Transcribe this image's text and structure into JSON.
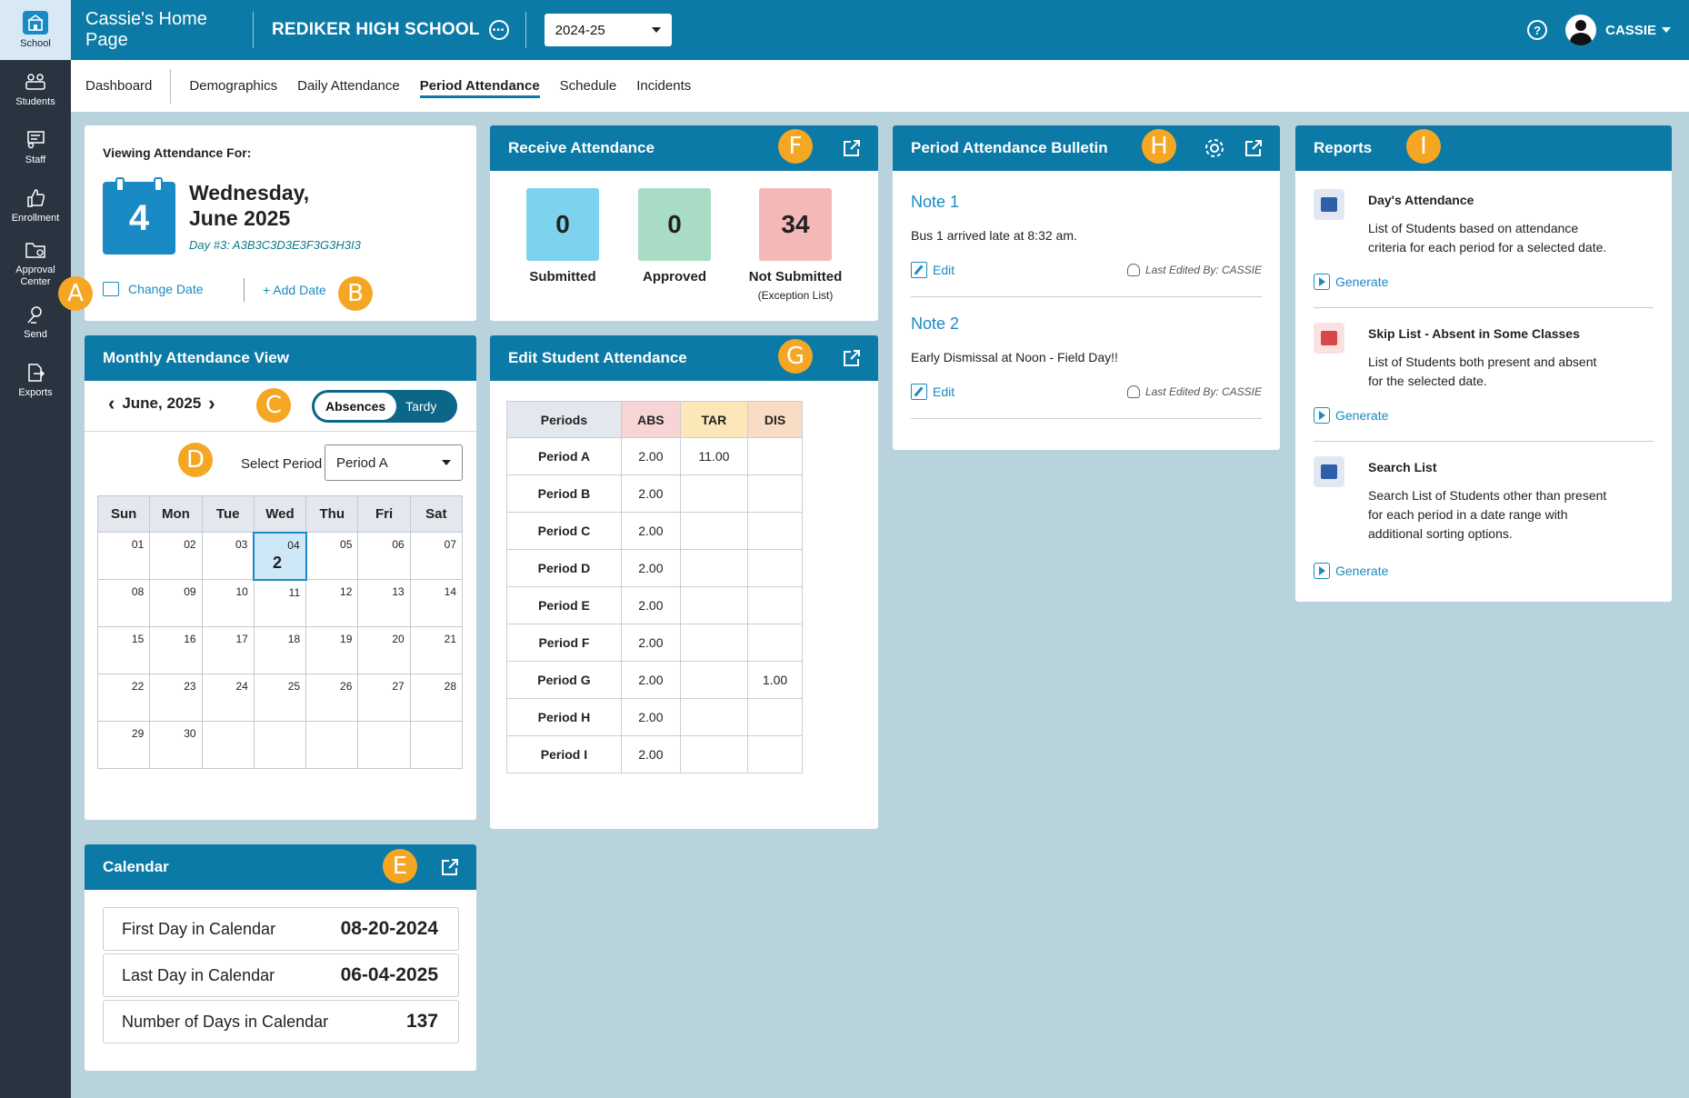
{
  "rail": [
    {
      "label": "School",
      "icon": "school-icon"
    },
    {
      "label": "Students",
      "icon": "students-icon"
    },
    {
      "label": "Staff",
      "icon": "staff-icon"
    },
    {
      "label": "Enrollment",
      "icon": "thumbs-up-icon"
    },
    {
      "label_1": "Approval",
      "label_2": "Center",
      "icon": "folder-icon"
    },
    {
      "label": "Send",
      "icon": "send-icon"
    },
    {
      "label": "Exports",
      "icon": "export-icon"
    }
  ],
  "topbar": {
    "home_title": "Cassie's Home Page",
    "school": "REDIKER HIGH SCHOOL",
    "year": "2024-25",
    "user": "CASSIE"
  },
  "subnav": [
    "Dashboard",
    "Demographics",
    "Daily Attendance",
    "Period Attendance",
    "Schedule",
    "Incidents"
  ],
  "viewing": {
    "label": "Viewing Attendance For:",
    "day_number": "4",
    "weekday": "Wednesday,",
    "month_year": "June 2025",
    "day_line": "Day #3:  A3B3C3D3E3F3G3H3I3",
    "change_date": "Change Date",
    "add_date": "+ Add Date"
  },
  "markers": {
    "a": "A",
    "b": "B",
    "c": "C",
    "d": "D",
    "e": "E",
    "f": "F",
    "g": "G",
    "h": "H",
    "i": "I"
  },
  "receive": {
    "title": "Receive Attendance",
    "submitted": {
      "value": "0",
      "label": "Submitted",
      "color": "#7dd3ee"
    },
    "approved": {
      "value": "0",
      "label": "Approved",
      "color": "#a8dcc4"
    },
    "not_submitted": {
      "value": "34",
      "label": "Not Submitted",
      "sub": "(Exception List)",
      "color": "#f5b8b8"
    }
  },
  "monthly": {
    "title": "Monthly Attendance View",
    "month": "June, 2025",
    "toggle_on": "Absences",
    "toggle_off": "Tardy",
    "select_label": "Select Period",
    "select_value": "Period A",
    "weekdays": [
      "Sun",
      "Mon",
      "Tue",
      "Wed",
      "Thu",
      "Fri",
      "Sat"
    ],
    "weeks": [
      [
        "01",
        "02",
        "03",
        "04",
        "05",
        "06",
        "07"
      ],
      [
        "08",
        "09",
        "10",
        "11",
        "12",
        "13",
        "14"
      ],
      [
        "15",
        "16",
        "17",
        "18",
        "19",
        "20",
        "21"
      ],
      [
        "22",
        "23",
        "24",
        "25",
        "26",
        "27",
        "28"
      ],
      [
        "29",
        "30",
        "",
        "",
        "",
        "",
        ""
      ]
    ],
    "selected_day": "04",
    "selected_count": "2"
  },
  "edit": {
    "title": "Edit Student Attendance",
    "headers": [
      "Periods",
      "ABS",
      "TAR",
      "DIS"
    ],
    "header_colors": [
      "#e3e8ee",
      "#f9d4d4",
      "#fbe7b8",
      "#f9dcc4"
    ],
    "rows": [
      [
        "Period A",
        "2.00",
        "11.00",
        ""
      ],
      [
        "Period B",
        "2.00",
        "",
        ""
      ],
      [
        "Period C",
        "2.00",
        "",
        ""
      ],
      [
        "Period D",
        "2.00",
        "",
        ""
      ],
      [
        "Period E",
        "2.00",
        "",
        ""
      ],
      [
        "Period F",
        "2.00",
        "",
        ""
      ],
      [
        "Period G",
        "2.00",
        "",
        "1.00"
      ],
      [
        "Period H",
        "2.00",
        "",
        ""
      ],
      [
        "Period I",
        "2.00",
        "",
        ""
      ]
    ]
  },
  "bulletin": {
    "title": "Period Attendance Bulletin",
    "notes": [
      {
        "title": "Note 1",
        "body": "Bus 1 arrived late at 8:32 am.",
        "edit": "Edit",
        "meta": "Last Edited By: CASSIE"
      },
      {
        "title": "Note 2",
        "body": "Early Dismissal at Noon - Field Day!!",
        "edit": "Edit",
        "meta": "Last Edited By: CASSIE"
      }
    ]
  },
  "reports": {
    "title": "Reports",
    "items": [
      {
        "title": "Day's Attendance",
        "desc": "List of Students based on attendance criteria for each period for a selected date.",
        "action": "Generate",
        "color": "#2f5fa8"
      },
      {
        "title": "Skip List - Absent in Some Classes",
        "desc": "List of Students both present and absent for the selected date.",
        "action": "Generate",
        "color": "#d94848"
      },
      {
        "title": "Search List",
        "desc": "Search List of Students other than present for each period in a date range with additional sorting options.",
        "action": "Generate",
        "color": "#2f5fa8"
      }
    ]
  },
  "calendar": {
    "title": "Calendar",
    "rows": [
      {
        "label": "First Day in Calendar",
        "value": "08-20-2024"
      },
      {
        "label": "Last Day in Calendar",
        "value": "06-04-2025"
      },
      {
        "label": "Number of Days in Calendar",
        "value": "137"
      }
    ]
  }
}
